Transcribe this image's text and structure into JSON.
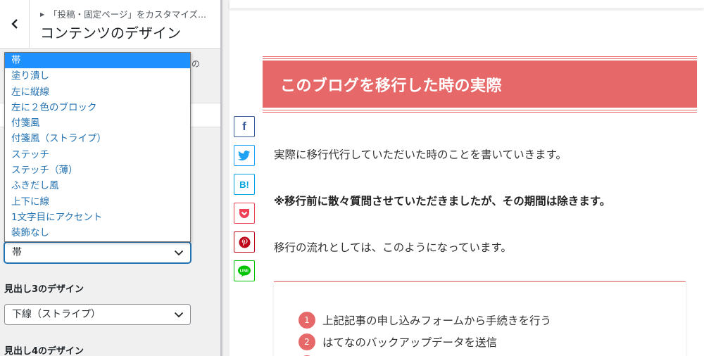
{
  "panel": {
    "breadcrumb": "「投稿・固定ページ」をカスタマイズ...",
    "title": "コンテンツのデザイン",
    "description_fragment": "の",
    "h2_select_value": "帯",
    "h3_label": "見出し3のデザイン",
    "h3_select_value": "下線（ストライプ）",
    "h4_label": "見出し4のデザイン"
  },
  "dropdown_options": [
    "帯",
    "塗り潰し",
    "左に縦線",
    "左に２色のブロック",
    "付箋風",
    "付箋風（ストライプ）",
    "ステッチ",
    "ステッチ（薄）",
    "ふきだし風",
    "上下に線",
    "1文字目にアクセント",
    "装飾なし"
  ],
  "preview": {
    "heading": "このブログを移行した時の実際",
    "para1": "実際に移行代行していただいた時のことを書いていきます。",
    "para2": "※移行前に散々質問させていただきましたが、その期間は除きます。",
    "para3": "移行の流れとしては、このようになっています。",
    "steps": [
      {
        "num": "1",
        "text": "上記記事の申し込みフォームから手続きを行う"
      },
      {
        "num": "2",
        "text": "はてなのバックアップデータを送信"
      }
    ]
  },
  "share_buttons": [
    {
      "name": "facebook",
      "glyph": "f",
      "color": "#3b5998"
    },
    {
      "name": "twitter",
      "glyph": "",
      "color": "#1da1f2"
    },
    {
      "name": "hatena",
      "glyph": "B!",
      "color": "#00a4de"
    },
    {
      "name": "pocket",
      "glyph": "",
      "color": "#ef4056"
    },
    {
      "name": "pinterest",
      "glyph": "",
      "color": "#bd081c"
    },
    {
      "name": "line",
      "glyph": "LINE",
      "color": "#00c300"
    }
  ],
  "colors": {
    "accent": "#e76868",
    "select_focus": "#2271b1",
    "option_highlight": "#1e90ff"
  }
}
